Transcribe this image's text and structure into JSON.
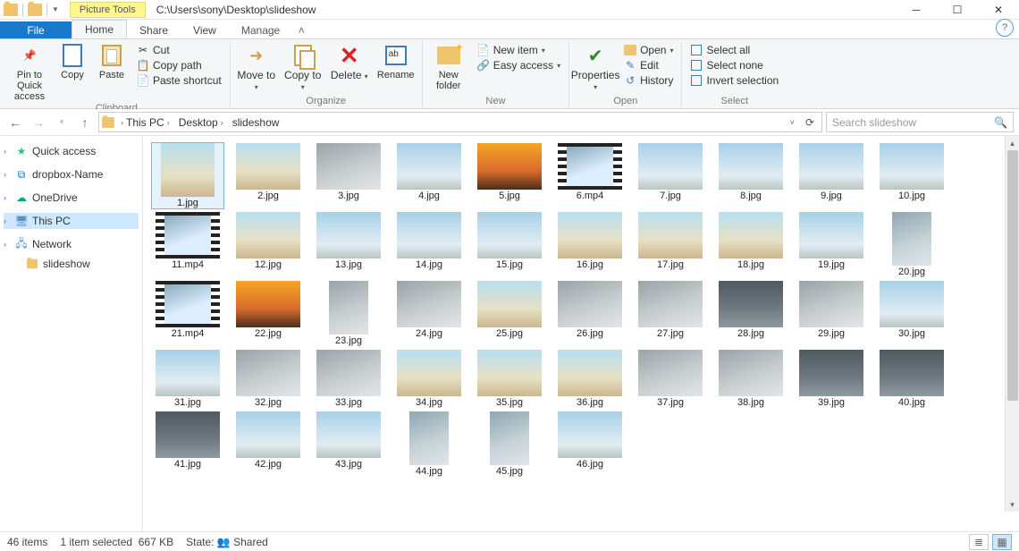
{
  "title_path": "C:\\Users\\sony\\Desktop\\slideshow",
  "picture_tools_label": "Picture Tools",
  "tabs": {
    "file": "File",
    "home": "Home",
    "share": "Share",
    "view": "View",
    "manage": "Manage"
  },
  "ribbon": {
    "clipboard": {
      "label": "Clipboard",
      "pin": "Pin to Quick access",
      "copy": "Copy",
      "paste": "Paste",
      "cut": "Cut",
      "copy_path": "Copy path",
      "paste_shortcut": "Paste shortcut"
    },
    "organize": {
      "label": "Organize",
      "move_to": "Move to",
      "copy_to": "Copy to",
      "delete": "Delete",
      "rename": "Rename"
    },
    "new": {
      "label": "New",
      "new_folder": "New folder",
      "new_item": "New item",
      "easy_access": "Easy access"
    },
    "open": {
      "label": "Open",
      "properties": "Properties",
      "open": "Open",
      "edit": "Edit",
      "history": "History"
    },
    "select": {
      "label": "Select",
      "select_all": "Select all",
      "select_none": "Select none",
      "invert": "Invert selection"
    }
  },
  "breadcrumbs": [
    "This PC",
    "Desktop",
    "slideshow"
  ],
  "search_placeholder": "Search slideshow",
  "sidebar": {
    "quick_access": "Quick access",
    "dropbox": "dropbox-Name",
    "onedrive": "OneDrive",
    "this_pc": "This PC",
    "network": "Network",
    "slideshow": "slideshow"
  },
  "files": [
    {
      "name": "1.jpg",
      "cls": "tall beach",
      "sel": true
    },
    {
      "name": "2.jpg",
      "cls": "beach"
    },
    {
      "name": "3.jpg",
      "cls": "rock"
    },
    {
      "name": "4.jpg",
      "cls": "sky"
    },
    {
      "name": "5.jpg",
      "cls": "sunset"
    },
    {
      "name": "6.mp4",
      "cls": "video"
    },
    {
      "name": "7.jpg",
      "cls": "sky"
    },
    {
      "name": "8.jpg",
      "cls": "sky"
    },
    {
      "name": "9.jpg",
      "cls": "sky"
    },
    {
      "name": "10.jpg",
      "cls": "sky"
    },
    {
      "name": "11.mp4",
      "cls": "video"
    },
    {
      "name": "12.jpg",
      "cls": "beach"
    },
    {
      "name": "13.jpg",
      "cls": "sky"
    },
    {
      "name": "14.jpg",
      "cls": "sky"
    },
    {
      "name": "15.jpg",
      "cls": "sky"
    },
    {
      "name": "16.jpg",
      "cls": "beach"
    },
    {
      "name": "17.jpg",
      "cls": "beach"
    },
    {
      "name": "18.jpg",
      "cls": "beach"
    },
    {
      "name": "19.jpg",
      "cls": "sky"
    },
    {
      "name": "20.jpg",
      "cls": "portrait"
    },
    {
      "name": "21.mp4",
      "cls": "video"
    },
    {
      "name": "22.jpg",
      "cls": "sunset"
    },
    {
      "name": "23.jpg",
      "cls": "portrait rock"
    },
    {
      "name": "24.jpg",
      "cls": "rock"
    },
    {
      "name": "25.jpg",
      "cls": "beach"
    },
    {
      "name": "26.jpg",
      "cls": "rock"
    },
    {
      "name": "27.jpg",
      "cls": "rock"
    },
    {
      "name": "28.jpg",
      "cls": "dark"
    },
    {
      "name": "29.jpg",
      "cls": "rock"
    },
    {
      "name": "30.jpg",
      "cls": "sky"
    },
    {
      "name": "31.jpg",
      "cls": "sky"
    },
    {
      "name": "32.jpg",
      "cls": "rock"
    },
    {
      "name": "33.jpg",
      "cls": "rock"
    },
    {
      "name": "34.jpg",
      "cls": "beach"
    },
    {
      "name": "35.jpg",
      "cls": "beach"
    },
    {
      "name": "36.jpg",
      "cls": "beach"
    },
    {
      "name": "37.jpg",
      "cls": "rock"
    },
    {
      "name": "38.jpg",
      "cls": "rock"
    },
    {
      "name": "39.jpg",
      "cls": "dark"
    },
    {
      "name": "40.jpg",
      "cls": "dark"
    },
    {
      "name": "41.jpg",
      "cls": "dark"
    },
    {
      "name": "42.jpg",
      "cls": "sky"
    },
    {
      "name": "43.jpg",
      "cls": "sky"
    },
    {
      "name": "44.jpg",
      "cls": "portrait"
    },
    {
      "name": "45.jpg",
      "cls": "portrait"
    },
    {
      "name": "46.jpg",
      "cls": "sky"
    }
  ],
  "status": {
    "count": "46 items",
    "selected": "1 item selected",
    "size": "667 KB",
    "state_label": "State:",
    "state_value": "Shared"
  }
}
